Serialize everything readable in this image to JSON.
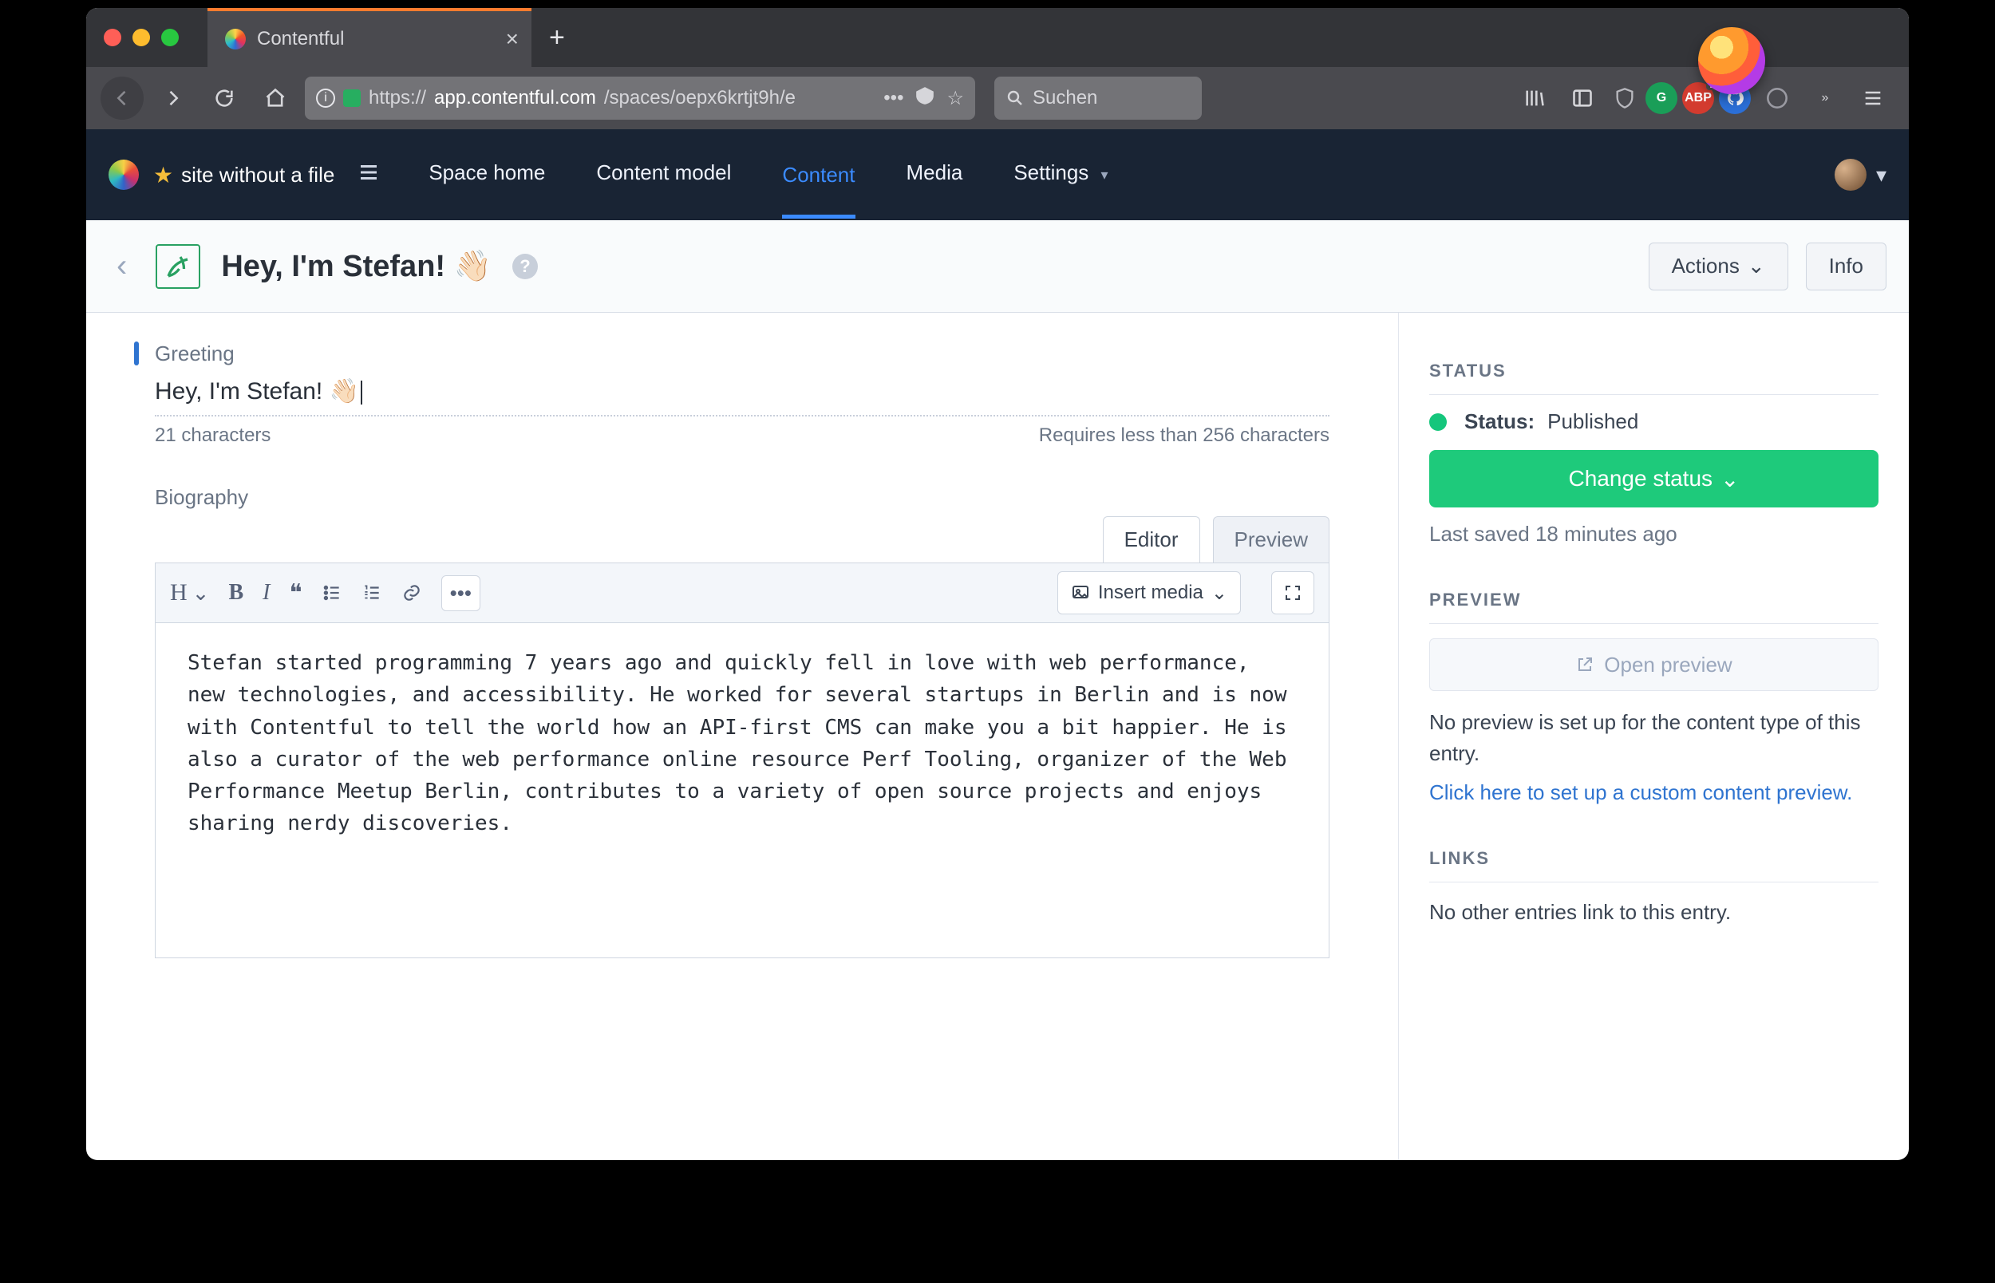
{
  "browser": {
    "tab_title": "Contentful",
    "url_host": "app.contentful.com",
    "url_scheme": "https://",
    "url_path": "/spaces/oepx6krtjt9h/e",
    "search_placeholder": "Suchen"
  },
  "header": {
    "space_name": "site without a file",
    "nav": {
      "space_home": "Space home",
      "content_model": "Content model",
      "content": "Content",
      "media": "Media",
      "settings": "Settings"
    }
  },
  "titlebar": {
    "title": "Hey, I'm Stefan! 👋🏻",
    "actions_label": "Actions",
    "info_label": "Info"
  },
  "fields": {
    "greeting": {
      "label": "Greeting",
      "value": "Hey, I'm Stefan! 👋🏻",
      "count_text": "21 characters",
      "requirement": "Requires less than 256 characters"
    },
    "biography": {
      "label": "Biography",
      "tabs": {
        "editor": "Editor",
        "preview": "Preview"
      },
      "toolbar": {
        "heading": "H",
        "insert_media": "Insert media"
      },
      "content": "Stefan started programming 7 years ago and quickly fell in love with web performance, new technologies, and accessibility. He worked for several startups in Berlin and is now with Contentful to tell the world how an API-first CMS can make you a bit happier. He is also a curator of the web performance online resource Perf Tooling, organizer of the Web Performance Meetup Berlin, contributes to a variety of open source projects and enjoys sharing nerdy discoveries."
    }
  },
  "sidebar": {
    "status_heading": "STATUS",
    "status_label": "Status:",
    "status_value": "Published",
    "change_status": "Change status",
    "last_saved": "Last saved 18 minutes ago",
    "preview_heading": "PREVIEW",
    "open_preview": "Open preview",
    "preview_note": "No preview is set up for the content type of this entry.",
    "preview_link": "Click here to set up a custom content preview.",
    "links_heading": "LINKS",
    "links_note": "No other entries link to this entry."
  }
}
